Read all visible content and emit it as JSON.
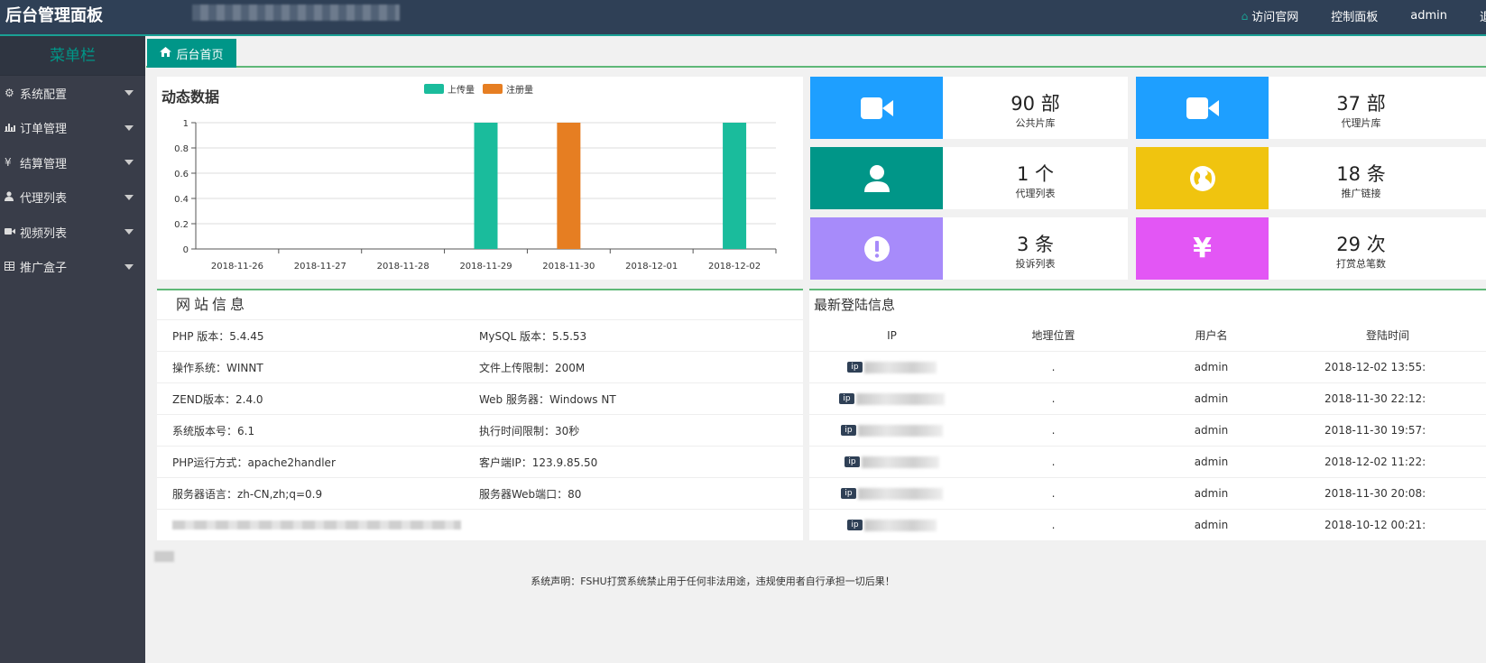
{
  "header": {
    "brand": "后台管理面板",
    "nav": [
      {
        "label": "访问官网",
        "icon": "home-icon"
      },
      {
        "label": "控制面板"
      },
      {
        "label": "admin"
      },
      {
        "label": "退"
      }
    ]
  },
  "sidebar": {
    "title": "菜单栏",
    "items": [
      {
        "label": "系统配置",
        "icon": "gear-icon"
      },
      {
        "label": "订单管理",
        "icon": "bar-chart-icon"
      },
      {
        "label": "结算管理",
        "icon": "yen-icon"
      },
      {
        "label": "代理列表",
        "icon": "user-icon"
      },
      {
        "label": "视频列表",
        "icon": "video-icon"
      },
      {
        "label": "推广盒子",
        "icon": "table-icon"
      }
    ]
  },
  "tabs": [
    {
      "label": "后台首页",
      "icon": "home-icon"
    }
  ],
  "chart": {
    "title": "动态数据"
  },
  "chart_data": {
    "type": "bar",
    "title": "动态数据",
    "categories": [
      "2018-11-26",
      "2018-11-27",
      "2018-11-28",
      "2018-11-29",
      "2018-11-30",
      "2018-12-01",
      "2018-12-02"
    ],
    "series": [
      {
        "name": "上传量",
        "color": "#1abc9c",
        "values": [
          0,
          0,
          0,
          1,
          0,
          0,
          1
        ]
      },
      {
        "name": "注册量",
        "color": "#e67e22",
        "values": [
          0,
          0,
          0,
          0,
          1,
          0,
          0
        ]
      }
    ],
    "yticks": [
      "0",
      "0.2",
      "0.4",
      "0.6",
      "0.8",
      "1"
    ],
    "ylim": [
      0,
      1
    ],
    "grid": true,
    "legend": "top-center"
  },
  "stats": [
    {
      "value": "90 部",
      "label": "公共片库",
      "icon": "video-camera-icon",
      "color": "#1e9fff"
    },
    {
      "value": "37 部",
      "label": "代理片库",
      "icon": "video-camera-icon",
      "color": "#1e9fff"
    },
    {
      "value": "1 个",
      "label": "代理列表",
      "icon": "user-icon",
      "color": "#009688"
    },
    {
      "value": "18 条",
      "label": "推广链接",
      "icon": "globe-icon",
      "color": "#f0c40f"
    },
    {
      "value": "3 条",
      "label": "投诉列表",
      "icon": "exclamation-icon",
      "color": "#a78bfa"
    },
    {
      "value": "29 次",
      "label": "打赏总笔数",
      "icon": "yen-icon",
      "color": "#e356f5"
    }
  ],
  "site_info": {
    "title": "网站信息",
    "rows": [
      [
        "PHP 版本：5.4.45",
        "MySQL 版本：5.5.53"
      ],
      [
        "操作系统：WINNT",
        "文件上传限制：200M"
      ],
      [
        "ZEND版本：2.4.0",
        "Web 服务器：Windows NT"
      ],
      [
        "系统版本号：6.1",
        "执行时间限制：30秒"
      ],
      [
        "PHP运行方式：apache2handler",
        "客户端IP：123.9.85.50"
      ],
      [
        "服务器语言：zh-CN,zh;q=0.9",
        "服务器Web端口：80"
      ]
    ]
  },
  "login_info": {
    "title": "最新登陆信息",
    "columns": [
      "IP",
      "地理位置",
      "用户名",
      "登陆时间"
    ],
    "badge": "ip",
    "rows": [
      {
        "loc": ".",
        "user": "admin",
        "time": "2018-12-02 13:55:"
      },
      {
        "loc": ".",
        "user": "admin",
        "time": "2018-11-30 22:12:"
      },
      {
        "loc": ".",
        "user": "admin",
        "time": "2018-11-30 19:57:"
      },
      {
        "loc": ".",
        "user": "admin",
        "time": "2018-12-02 11:22:"
      },
      {
        "loc": ".",
        "user": "admin",
        "time": "2018-11-30 20:08:"
      },
      {
        "loc": ".",
        "user": "admin",
        "time": "2018-10-12 00:21:"
      }
    ]
  },
  "footer": "系统声明：FSHU打赏系统禁止用于任何非法用途，违规使用者自行承担一切后果！"
}
